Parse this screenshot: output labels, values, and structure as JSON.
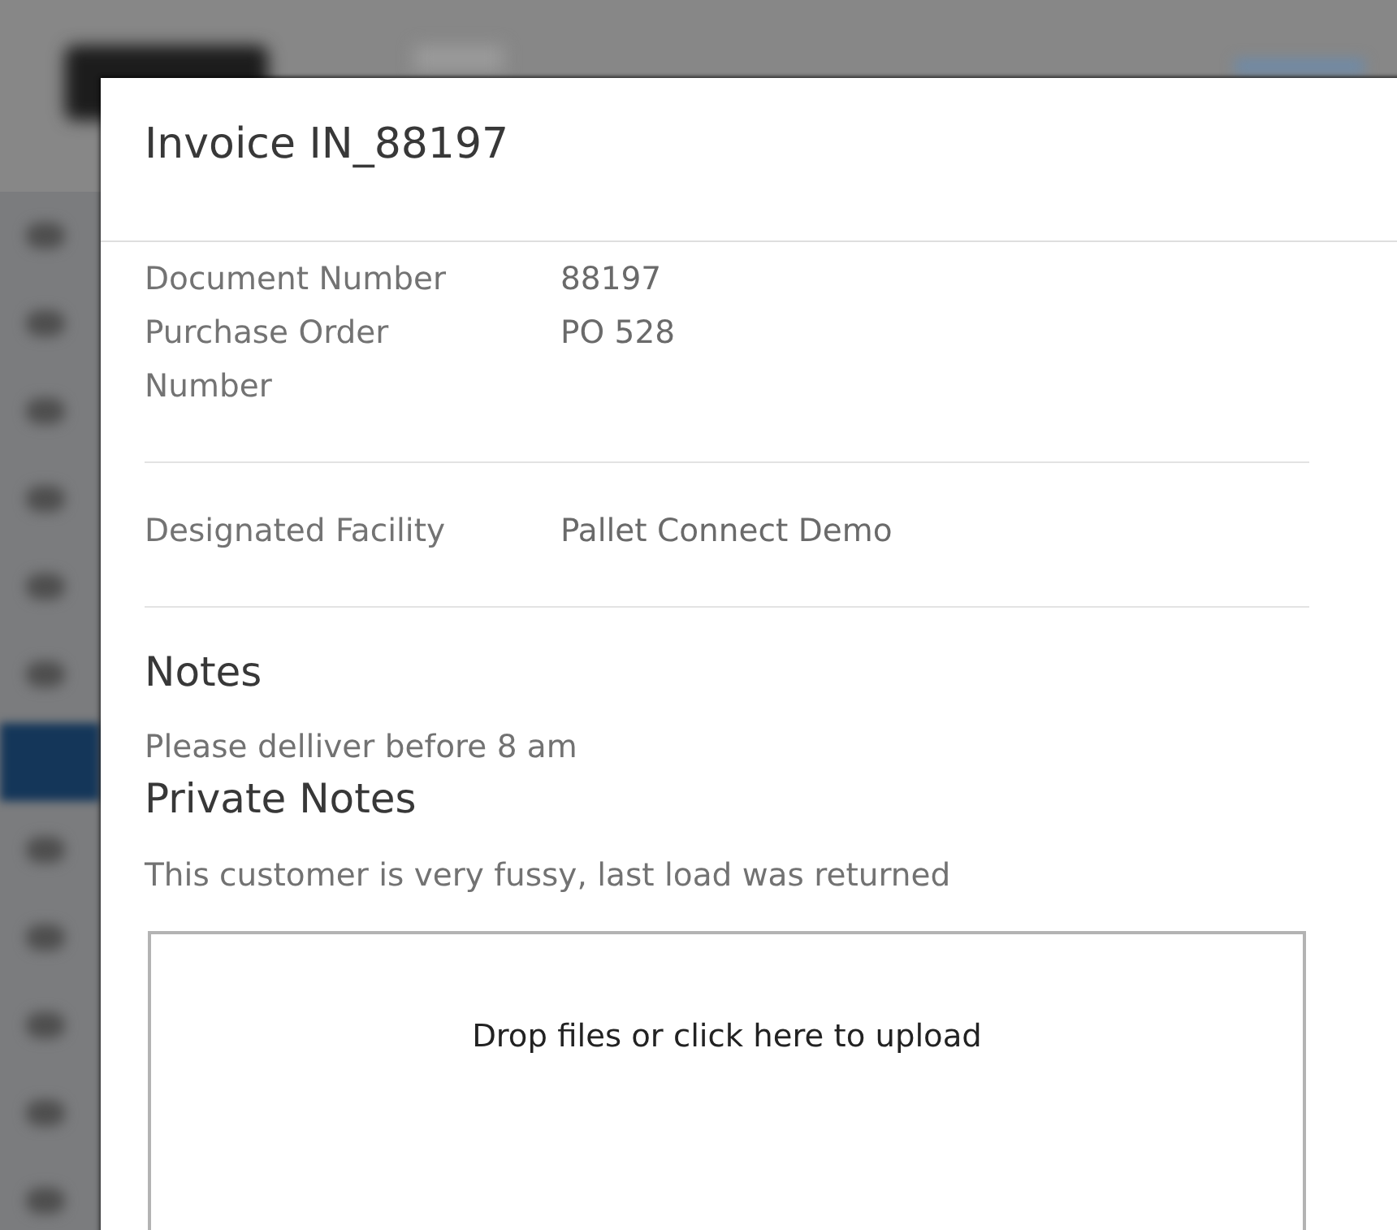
{
  "background": {
    "sidebar_items": [
      {
        "selected": false
      },
      {
        "selected": false
      },
      {
        "selected": false
      },
      {
        "selected": false
      },
      {
        "selected": false
      },
      {
        "selected": false
      },
      {
        "selected": true
      },
      {
        "selected": false
      },
      {
        "selected": false
      },
      {
        "selected": false
      },
      {
        "selected": false
      },
      {
        "selected": false
      }
    ]
  },
  "dialog": {
    "title": "Invoice IN_88197"
  },
  "field_groups": [
    {
      "fields": [
        {
          "label": "Document Number",
          "value": "88197"
        },
        {
          "label": "Purchase Order Number",
          "value": "PO 528"
        }
      ]
    },
    {
      "fields": [
        {
          "label": "Designated Facility",
          "value": "Pallet Connect Demo"
        }
      ]
    }
  ],
  "notes": {
    "heading": "Notes",
    "text": "Please delliver before 8 am"
  },
  "private_notes": {
    "heading": "Private Notes",
    "text": "This customer is very fussy, last load was returned"
  },
  "upload": {
    "prompt": "Drop files or click here to upload"
  }
}
